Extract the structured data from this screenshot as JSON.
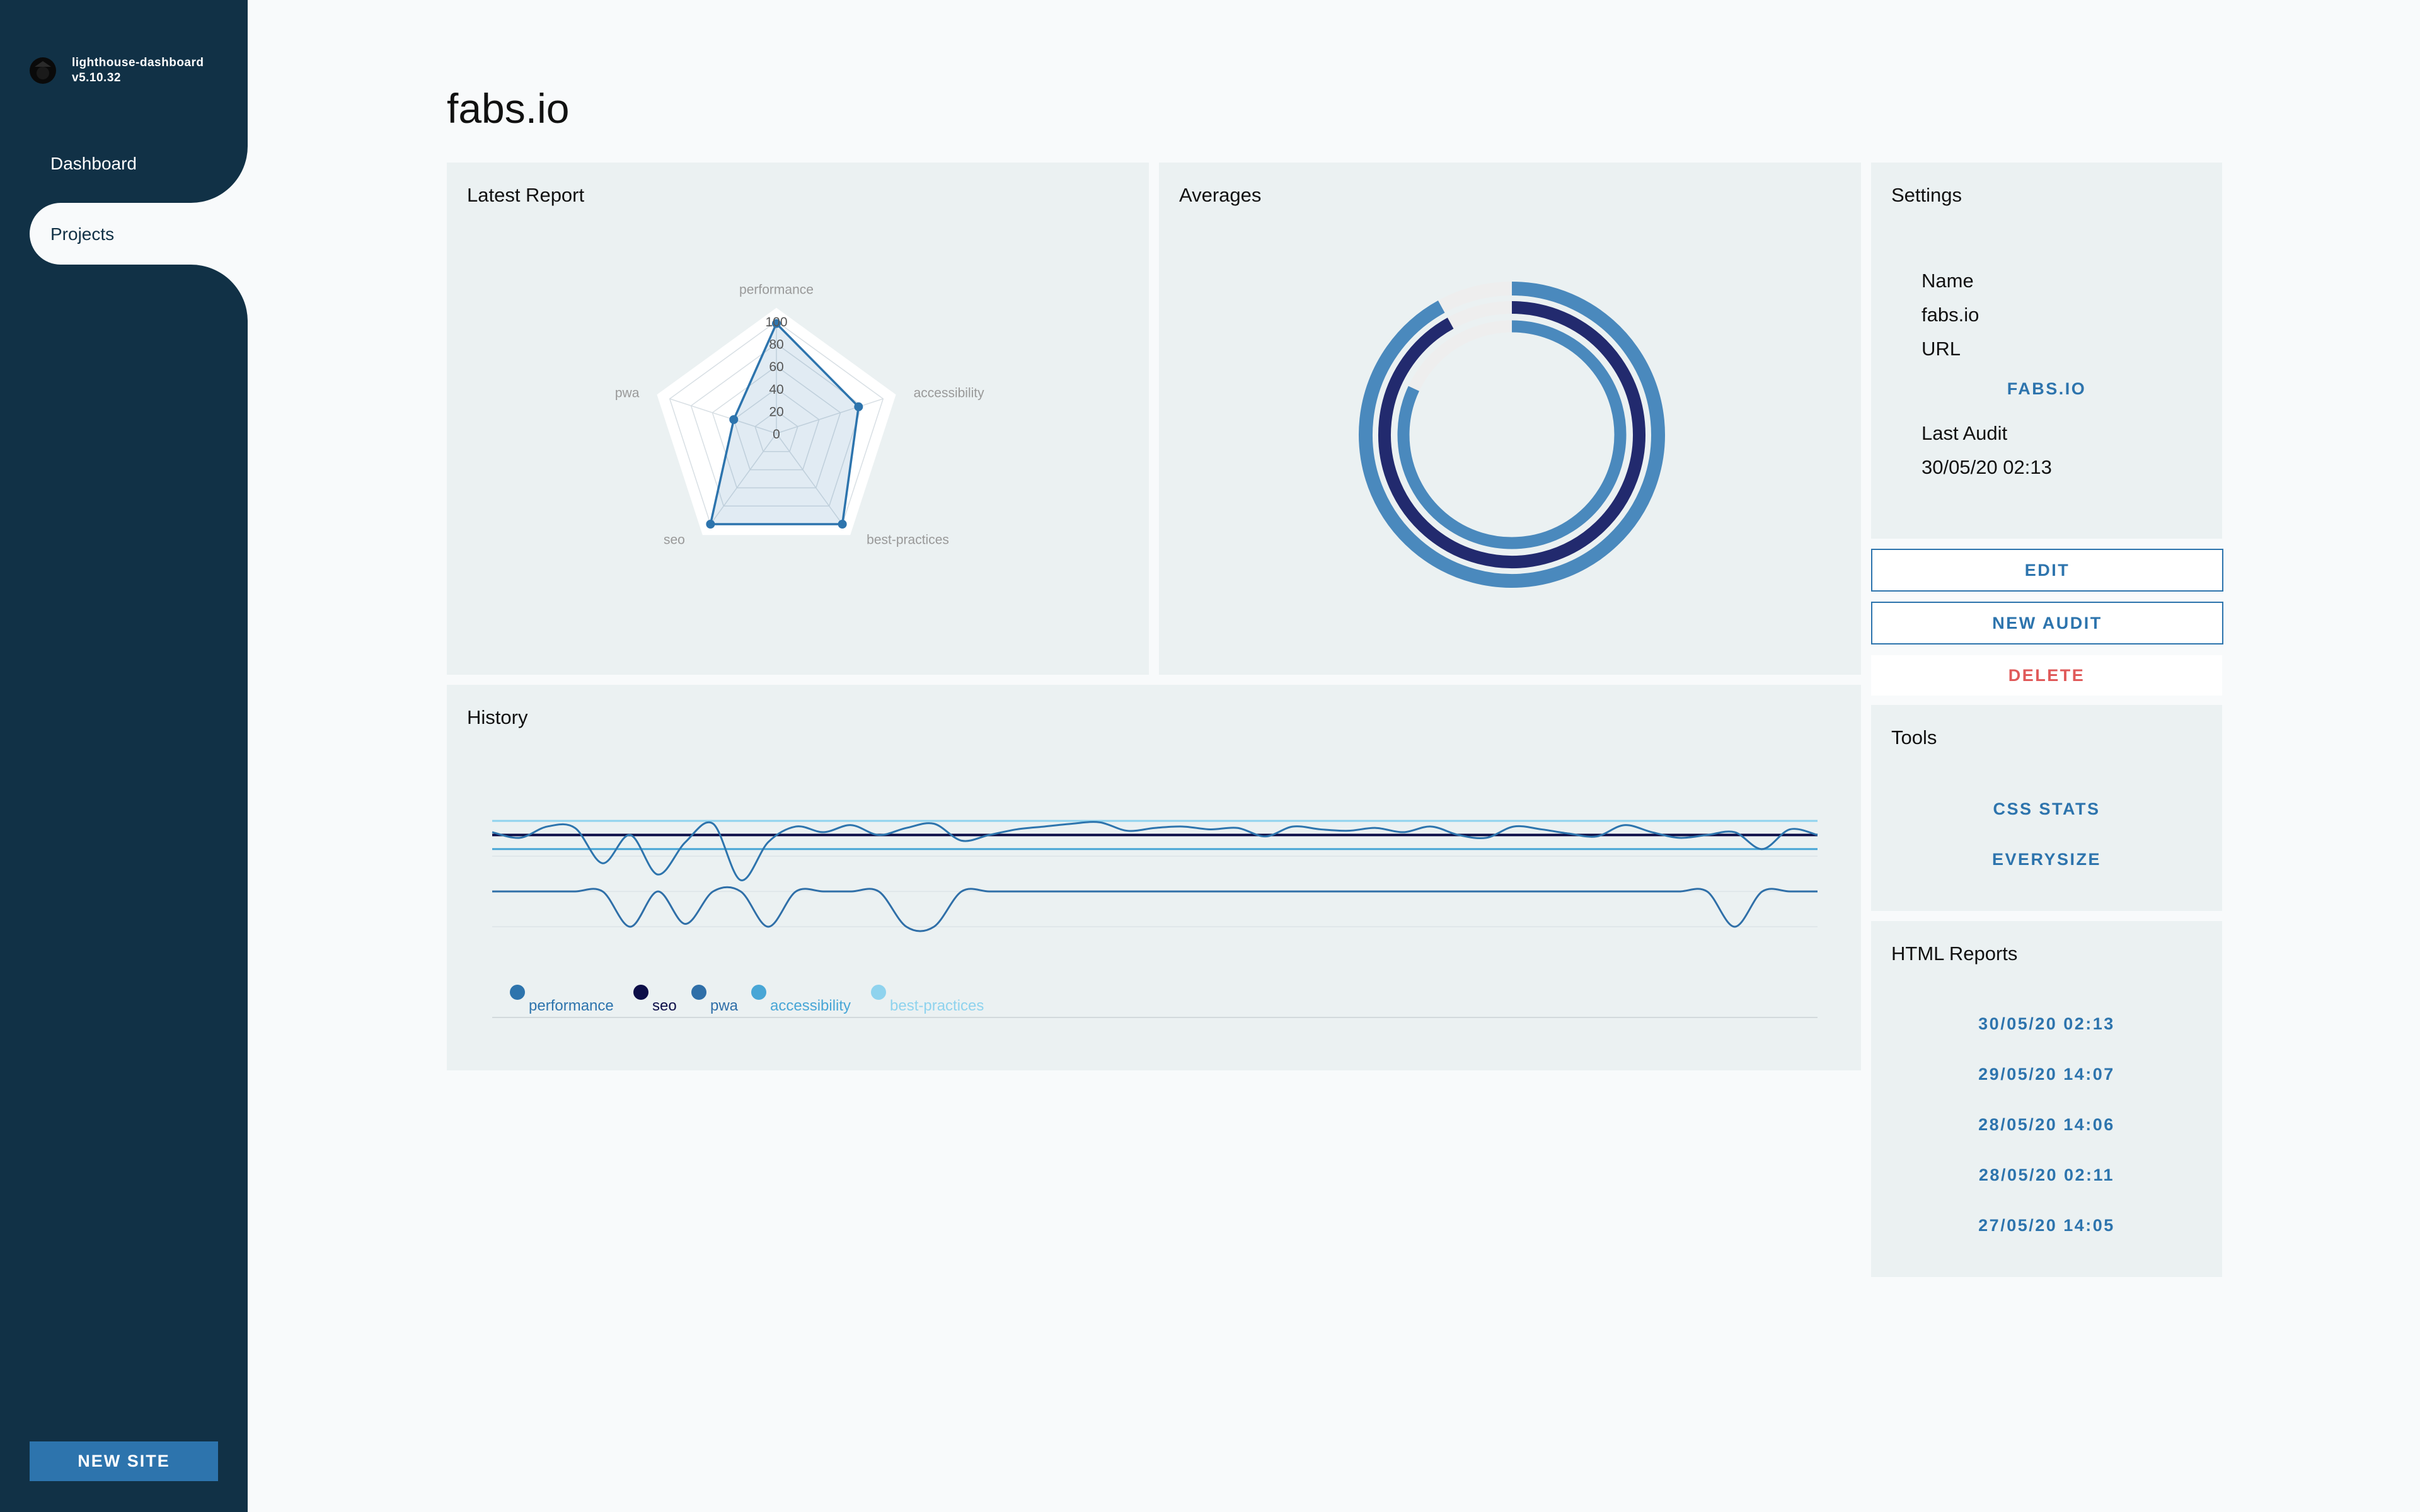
{
  "app": {
    "name": "lighthouse-dashboard",
    "version": "v5.10.32"
  },
  "sidebar": {
    "items": [
      {
        "label": "Dashboard"
      },
      {
        "label": "Projects"
      }
    ],
    "new_site_label": "NEW SITE"
  },
  "page": {
    "title": "fabs.io"
  },
  "latest_report": {
    "title": "Latest Report",
    "chart_data": {
      "type": "radar",
      "axes": [
        "performance",
        "accessibility",
        "best-practices",
        "seo",
        "pwa"
      ],
      "tick_labels": [
        "0",
        "20",
        "40",
        "60",
        "80",
        "100"
      ],
      "values": [
        98,
        77,
        100,
        100,
        40
      ],
      "range": [
        0,
        100
      ]
    }
  },
  "averages": {
    "title": "Averages",
    "chart_data": {
      "type": "radial-bar",
      "series": [
        {
          "value": 92,
          "color": "#4a89bd"
        },
        {
          "value": 92,
          "color": "#222a6e"
        },
        {
          "value": 82,
          "color": "#4a89bd"
        }
      ],
      "range": [
        0,
        100
      ]
    }
  },
  "history": {
    "title": "History",
    "chart_data": {
      "type": "line",
      "range": [
        0,
        100
      ],
      "series": [
        {
          "name": "performance",
          "color": "#2d74ad",
          "values": [
            92,
            88,
            96,
            95,
            70,
            90,
            62,
            85,
            98,
            58,
            85,
            96,
            92,
            97,
            90,
            95,
            98,
            86,
            90,
            94,
            96,
            98,
            99,
            93,
            95,
            96,
            94,
            95,
            89,
            96,
            94,
            93,
            95,
            92,
            96,
            90,
            88,
            96,
            94,
            91,
            89,
            97,
            92,
            88,
            90,
            92,
            80,
            94,
            90
          ]
        },
        {
          "name": "seo",
          "color": "#0c0e48",
          "values": [
            90,
            90,
            90,
            90,
            90,
            90,
            90,
            90,
            90,
            90,
            90,
            90,
            90,
            90,
            90,
            90,
            90,
            90,
            90,
            90,
            90,
            90,
            90,
            90,
            90,
            90,
            90,
            90,
            90,
            90,
            90,
            90,
            90,
            90,
            90,
            90,
            90,
            90,
            90,
            90,
            90,
            90,
            90,
            90,
            90,
            90,
            90,
            90,
            90
          ]
        },
        {
          "name": "pwa",
          "color": "#2f6fa8",
          "values": [
            50,
            50,
            50,
            50,
            50,
            25,
            50,
            27,
            50,
            50,
            25,
            50,
            50,
            50,
            50,
            25,
            25,
            50,
            50,
            50,
            50,
            50,
            50,
            50,
            50,
            50,
            50,
            50,
            50,
            50,
            50,
            50,
            50,
            50,
            50,
            50,
            50,
            50,
            50,
            50,
            50,
            50,
            50,
            50,
            50,
            25,
            50,
            50,
            50
          ]
        },
        {
          "name": "accessibility",
          "color": "#48a6d6",
          "values": [
            80,
            80,
            80,
            80,
            80,
            80,
            80,
            80,
            80,
            80,
            80,
            80,
            80,
            80,
            80,
            80,
            80,
            80,
            80,
            80,
            80,
            80,
            80,
            80,
            80,
            80,
            80,
            80,
            80,
            80,
            80,
            80,
            80,
            80,
            80,
            80,
            80,
            80,
            80,
            80,
            80,
            80,
            80,
            80,
            80,
            80,
            80,
            80,
            80
          ]
        },
        {
          "name": "best-practices",
          "color": "#8fd3ee",
          "values": [
            100,
            100,
            100,
            100,
            100,
            100,
            100,
            100,
            100,
            100,
            100,
            100,
            100,
            100,
            100,
            100,
            100,
            100,
            100,
            100,
            100,
            100,
            100,
            100,
            100,
            100,
            100,
            100,
            100,
            100,
            100,
            100,
            100,
            100,
            100,
            100,
            100,
            100,
            100,
            100,
            100,
            100,
            100,
            100,
            100,
            100,
            100,
            100,
            100
          ]
        }
      ]
    }
  },
  "settings": {
    "title": "Settings",
    "name_label": "Name",
    "name_value": "fabs.io",
    "url_label": "URL",
    "url_link": "FABS.IO",
    "last_audit_label": "Last Audit",
    "last_audit_value": "30/05/20 02:13"
  },
  "actions": {
    "edit": "EDIT",
    "new_audit": "NEW AUDIT",
    "delete": "DELETE"
  },
  "tools": {
    "title": "Tools",
    "items": [
      "CSS STATS",
      "EVERYSIZE"
    ]
  },
  "html_reports": {
    "title": "HTML Reports",
    "items": [
      "30/05/20 02:13",
      "29/05/20 14:07",
      "28/05/20 14:06",
      "28/05/20 02:11",
      "27/05/20 14:05"
    ]
  },
  "colors": {
    "sidebar": "#113146",
    "accent": "#2d74ad",
    "danger": "#e05a5a",
    "card": "#ebf1f2"
  }
}
